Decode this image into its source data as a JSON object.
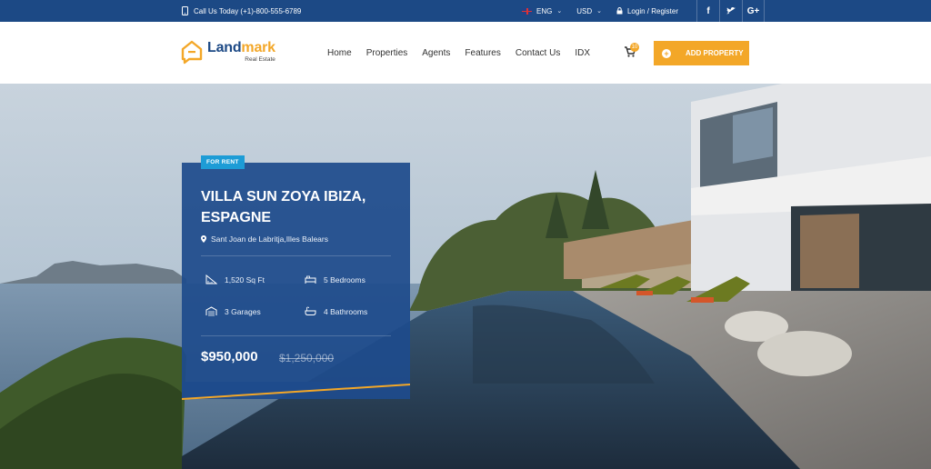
{
  "topbar": {
    "phone": "Call Us Today (+1)-800-555-6789",
    "language": "ENG",
    "currency": "USD",
    "login": "Login / Register",
    "social": [
      "f",
      "t",
      "G+"
    ]
  },
  "header": {
    "logo_main": "Land",
    "logo_accent": "mark",
    "logo_tagline": "Real Estate",
    "nav": [
      "Home",
      "Properties",
      "Agents",
      "Features",
      "Contact Us",
      "IDX"
    ],
    "cart_count": "10",
    "add_property": "ADD PROPERTY"
  },
  "listing": {
    "badge": "FOR RENT",
    "title": "VILLA SUN ZOYA IBIZA, ESPAGNE",
    "location": "Sant Joan de Labritja,Illes Balears",
    "area": "1,520 Sq Ft",
    "bedrooms": "5 Bedrooms",
    "garages": "3 Garages",
    "bathrooms": "4 Bathrooms",
    "price": "$950,000",
    "old_price": "$1,250,000"
  },
  "colors": {
    "primary": "#1c4985",
    "accent": "#f3a728",
    "badge": "#1d9cd6"
  }
}
